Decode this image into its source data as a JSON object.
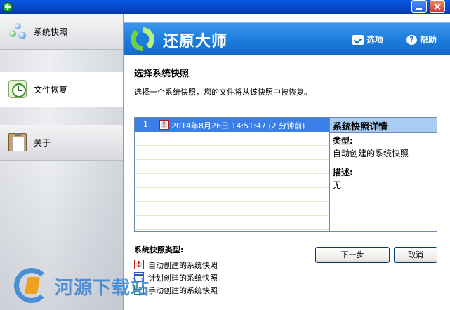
{
  "app": {
    "title": "还原大师",
    "options_label": "选项",
    "help_label": "帮助"
  },
  "sidebar": {
    "items": [
      {
        "label": "系统快照",
        "icon": "network-icon"
      },
      {
        "label": "文件恢复",
        "icon": "clock-icon"
      },
      {
        "label": "关于",
        "icon": "clipboard-icon"
      }
    ]
  },
  "main": {
    "section_title": "选择系统快照",
    "instructions": "选择一个系统快照，您的文件将从该快照中被恢复。",
    "snapshots": [
      {
        "index": "1",
        "label": "2014年8月26日 14:51:47 (2 分钟前)"
      }
    ],
    "details": {
      "heading": "系统快照详情",
      "type_label": "类型:",
      "type_value": "自动创建的系统快照",
      "desc_label": "描述:",
      "desc_value": "无"
    },
    "legend": {
      "title": "系统快照类型:",
      "items": [
        {
          "label": "自动创建的系统快照",
          "icon": "auto-snapshot-icon"
        },
        {
          "label": "计划创建的系统快照",
          "icon": "scheduled-snapshot-icon"
        },
        {
          "label": "手动创建的系统快照",
          "icon": "manual-snapshot-icon"
        }
      ]
    },
    "buttons": {
      "next": "下一步",
      "cancel": "取消"
    }
  },
  "watermark": {
    "text": "河源下载站"
  },
  "colors": {
    "header_blue": "#1c7cdd",
    "selection_blue": "#3a7ee8",
    "details_header": "#a9ccf2"
  }
}
